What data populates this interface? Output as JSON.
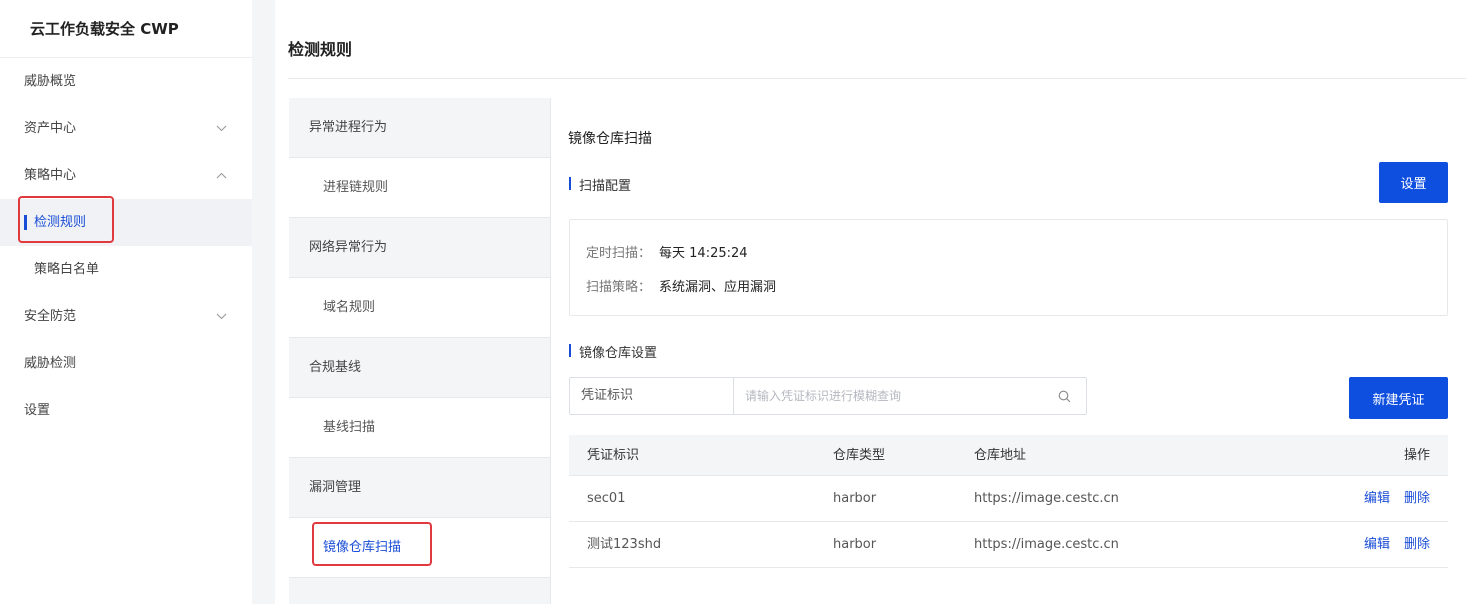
{
  "sidebar": {
    "brand": "云工作负载安全 CWP",
    "items": [
      {
        "label": "威胁概览"
      },
      {
        "label": "资产中心"
      },
      {
        "label": "策略中心"
      },
      {
        "label": "检测规则"
      },
      {
        "label": "策略白名单"
      },
      {
        "label": "安全防范"
      },
      {
        "label": "威胁检测"
      },
      {
        "label": "设置"
      }
    ]
  },
  "page": {
    "title": "检测规则"
  },
  "categories": [
    {
      "label": "异常进程行为"
    },
    {
      "label": "进程链规则"
    },
    {
      "label": "网络异常行为"
    },
    {
      "label": "域名规则"
    },
    {
      "label": "合规基线"
    },
    {
      "label": "基线扫描"
    },
    {
      "label": "漏洞管理"
    },
    {
      "label": "镜像仓库扫描"
    }
  ],
  "panel": {
    "title": "镜像仓库扫描",
    "scan_config": {
      "heading": "扫描配置",
      "settings_button": "设置",
      "schedule_label": "定时扫描：",
      "schedule_value": "每天 14:25:24",
      "policy_label": "扫描策略：",
      "policy_value": "系统漏洞、应用漏洞"
    },
    "repo_settings": {
      "heading": "镜像仓库设置",
      "search_field": "凭证标识",
      "search_placeholder": "请输入凭证标识进行模糊查询",
      "new_button": "新建凭证"
    },
    "table": {
      "columns": [
        "凭证标识",
        "仓库类型",
        "仓库地址",
        "操作"
      ],
      "rows": [
        {
          "id": "sec01",
          "type": "harbor",
          "url": "https://image.cestc.cn",
          "edit": "编辑",
          "delete": "删除"
        },
        {
          "id": "测试123shd",
          "type": "harbor",
          "url": "https://image.cestc.cn",
          "edit": "编辑",
          "delete": "删除"
        }
      ]
    }
  },
  "colors": {
    "accent": "#1a4dd6",
    "button": "#0f4fe0",
    "highlight_box": "#e0393e"
  },
  "icons": [
    "chevron-down-icon",
    "chevron-up-icon",
    "search-icon"
  ]
}
